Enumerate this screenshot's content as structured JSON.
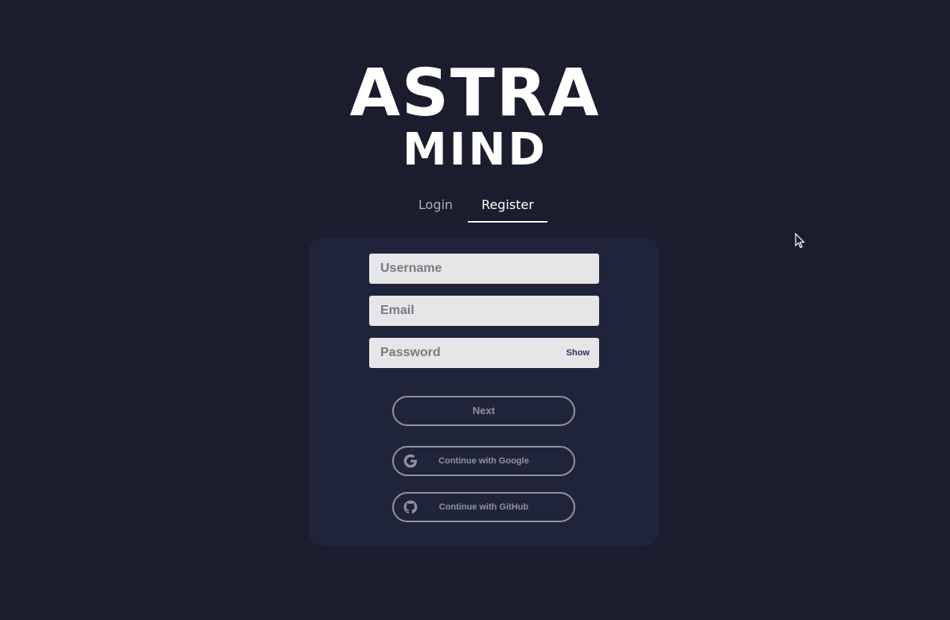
{
  "brand": {
    "line1": "ASTRA",
    "line2": "MIND"
  },
  "tabs": [
    {
      "label": "Login",
      "active": false
    },
    {
      "label": "Register",
      "active": true
    }
  ],
  "form": {
    "username_placeholder": "Username",
    "email_placeholder": "Email",
    "password_placeholder": "Password",
    "show_label": "Show",
    "next_label": "Next",
    "google_label": "Continue with Google",
    "github_label": "Continue with GitHub"
  },
  "icons": {
    "google": "google-icon",
    "github": "github-icon"
  },
  "colors": {
    "background": "#1b1d2e",
    "card": "#20243a",
    "input": "#e6e6e8",
    "outline_button": "#8e92a2",
    "show_text": "#26306a"
  }
}
